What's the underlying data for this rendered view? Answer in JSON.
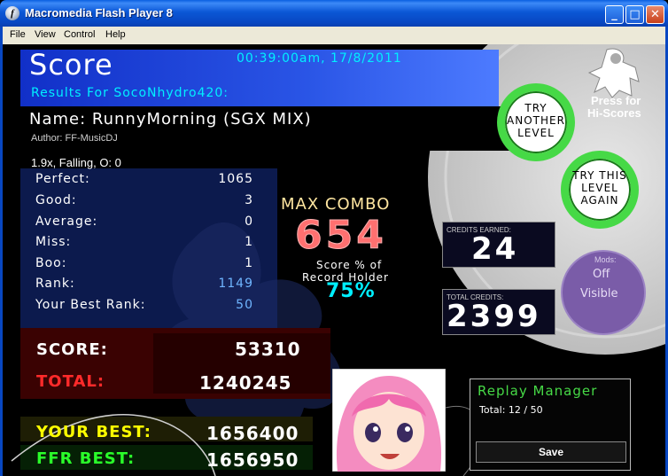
{
  "window": {
    "title": "Macromedia Flash Player 8",
    "icon": "flash-player-icon",
    "controls": {
      "minimize": "_",
      "maximize": "□",
      "close": "✕"
    }
  },
  "menu": [
    "File",
    "View",
    "Control",
    "Help"
  ],
  "results": {
    "header_title": "Score",
    "timestamp": "00:39:00am, 17/8/2011",
    "results_for": "Results For SocoNhydro420:",
    "song_name": "Name: RunnyMorning (SGX MIX)",
    "author": "Author: FF-MusicDJ",
    "settings": "1.9x, Falling, O: 0",
    "judgements": [
      {
        "label": "Perfect:",
        "value": "1065"
      },
      {
        "label": "Good:",
        "value": "3"
      },
      {
        "label": "Average:",
        "value": "0"
      },
      {
        "label": "Miss:",
        "value": "1"
      },
      {
        "label": "Boo:",
        "value": "1"
      },
      {
        "label": "Rank:",
        "value": "1149"
      },
      {
        "label": "Your Best Rank:",
        "value": "50"
      }
    ],
    "max_combo_label": "MAX COMBO",
    "max_combo": "654",
    "record_label_1": "Score % of",
    "record_label_2": "Record Holder",
    "record_pct": "75%",
    "credits_earned_label": "CREDITS EARNED:",
    "credits_earned": "24",
    "total_credits_label": "TOTAL CREDITS:",
    "total_credits": "2399",
    "mods_label": "Mods:",
    "mods": [
      "Off",
      "Visible"
    ],
    "score_label": "SCORE:",
    "score": "53310",
    "total_label": "TOTAL:",
    "total": "1240245",
    "your_best_label": "YOUR BEST:",
    "your_best": "1656400",
    "ffr_best_label": "FFR BEST:",
    "ffr_best": "1656950"
  },
  "buttons": {
    "try_another_1": "TRY",
    "try_another_2": "ANOTHER",
    "try_another_3": "LEVEL",
    "try_again_1": "TRY THIS",
    "try_again_2": "LEVEL",
    "try_again_3": "AGAIN",
    "hiscores_1": "Press for",
    "hiscores_2": "Hi-Scores"
  },
  "replay": {
    "title": "Replay Manager",
    "total": "Total: 12 / 50",
    "save": "Save"
  },
  "colors": {
    "header_blue": "#1a3fd0",
    "cyan_text": "#00f0ff",
    "green_ring": "#46d946",
    "mods_purple": "#7a5ca8",
    "total_red": "#ff2a2a",
    "best_yellow": "#ffff00",
    "ffr_green": "#2aff2a"
  }
}
